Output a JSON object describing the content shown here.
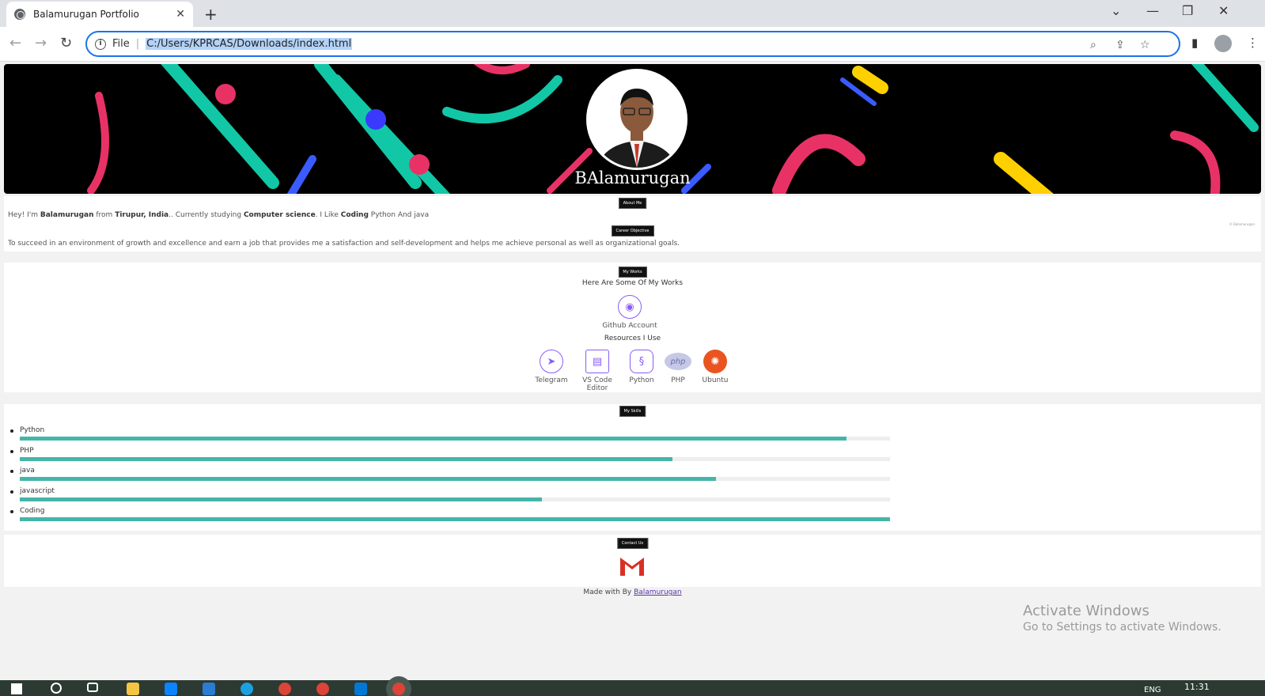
{
  "browser": {
    "tab_title": "Balamurugan Portfolio",
    "tab_close": "✕",
    "new_tab": "+",
    "file_label": "File",
    "url": "C:/Users/KPRCAS/Downloads/index.html"
  },
  "hero": {
    "name": "BAlamurugan"
  },
  "about": {
    "label": "About Me",
    "intro_1": "Hey! I'm ",
    "intro_name": "Balamurugan",
    "intro_2": " from ",
    "intro_place": "Tirupur, India",
    "intro_3": ".. Currently studying ",
    "intro_course": "Computer science",
    "intro_4": ". I Like ",
    "intro_like": "Coding",
    "intro_5": " Python And java",
    "side_note": "© Balamurugan",
    "objective_label": "Career Objective",
    "objective": "To succeed in an environment of growth and excellence and earn a job that provides me a satisfaction and self-development and helps me achieve personal as well as organizational goals."
  },
  "works": {
    "label": "My Works",
    "heading": "Here Are Some Of My Works",
    "github_label": "Github Account",
    "resources_heading": "Resources I Use",
    "resources": [
      {
        "label": "Telegram",
        "icon": "telegram-icon"
      },
      {
        "label": "VS Code Editor",
        "icon": "vscode-icon"
      },
      {
        "label": "Python",
        "icon": "python-icon"
      },
      {
        "label": "PHP",
        "icon": "php-icon"
      },
      {
        "label": "Ubuntu",
        "icon": "ubuntu-icon"
      }
    ]
  },
  "skills": {
    "label": "My Skills",
    "items": [
      {
        "name": "Python",
        "level": 0.95
      },
      {
        "name": "PHP",
        "level": 0.75
      },
      {
        "name": "java",
        "level": 0.8
      },
      {
        "name": "javascript",
        "level": 0.6
      },
      {
        "name": "Coding",
        "level": 1.0
      }
    ]
  },
  "contact": {
    "label": "Contact Us"
  },
  "footer": {
    "made_by": "Made with By ",
    "author": "Balamurugan"
  },
  "watermark": {
    "line1": "Activate Windows",
    "line2": "Go to Settings to activate Windows."
  },
  "taskbar": {
    "lang": "ENG",
    "time": "11:31"
  },
  "colors": {
    "accent": "#45b5a7",
    "omnibox_border": "#1a73e8",
    "taskbar": "#2c3a33"
  }
}
